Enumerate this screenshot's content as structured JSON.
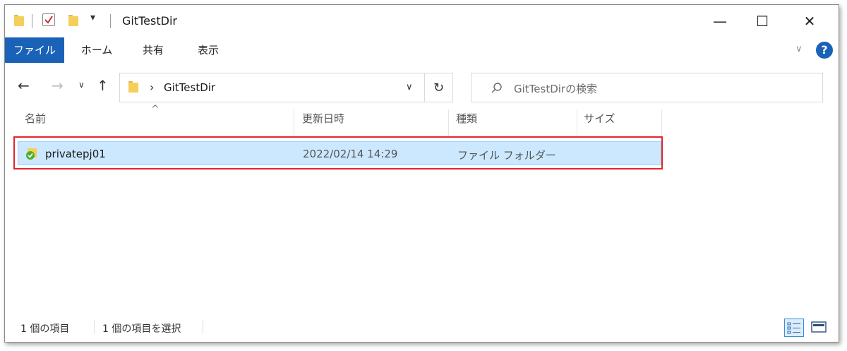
{
  "window": {
    "title": "GitTestDir",
    "controls": {
      "minimize": "—",
      "maximize": "☐",
      "close": "✕"
    }
  },
  "ribbon": {
    "tabs": [
      "ファイル",
      "ホーム",
      "共有",
      "表示"
    ],
    "expand_glyph": "∨",
    "help_glyph": "?"
  },
  "address": {
    "path_segment": "GitTestDir",
    "separator": "›",
    "dropdown_glyph": "∨",
    "refresh_glyph": "↻"
  },
  "search": {
    "placeholder": "GitTestDirの検索"
  },
  "columns": {
    "name": "名前",
    "modified": "更新日時",
    "type": "種類",
    "size": "サイズ"
  },
  "sort_glyph": "^",
  "rows": [
    {
      "name": "privatepj01",
      "modified": "2022/02/14 14:29",
      "type": "ファイル フォルダー",
      "size": ""
    }
  ],
  "status": {
    "count": "1 個の項目",
    "selected": "1 個の項目を選択"
  },
  "colors": {
    "accent": "#1a62b8",
    "selection_bg": "#cce8ff",
    "highlight_border": "#e0262b",
    "help": "#1a62b8"
  }
}
